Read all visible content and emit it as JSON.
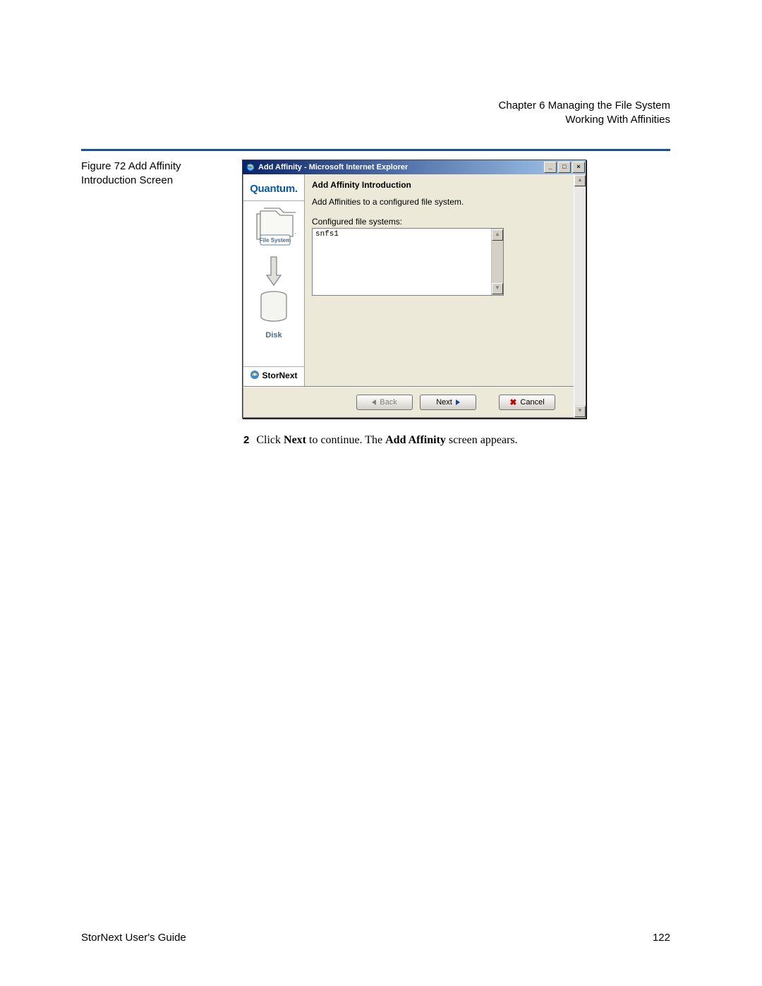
{
  "header": {
    "chapter": "Chapter 6  Managing the File System",
    "section": "Working With Affinities"
  },
  "figure": {
    "label_line1": "Figure 72  Add Affinity",
    "label_line2": "Introduction Screen"
  },
  "window": {
    "title": "Add Affinity - Microsoft Internet Explorer",
    "min": "_",
    "max": "□",
    "close": "×"
  },
  "sidebar": {
    "logo": "Quantum.",
    "fs_label": "File System",
    "disk_label": "Disk",
    "product": "StorNext"
  },
  "main": {
    "heading": "Add Affinity Introduction",
    "description": "Add Affinities to a configured file system.",
    "cfg_label": "Configured file systems:",
    "list_items": [
      "snfs1"
    ]
  },
  "buttons": {
    "back": "Back",
    "next": "Next",
    "cancel": "Cancel"
  },
  "instruction": {
    "num": "2",
    "prefix": "Click ",
    "bold1": "Next",
    "mid": " to continue. The ",
    "bold2": "Add Affinity",
    "suffix": " screen appears."
  },
  "footer": {
    "guide": "StorNext User's Guide",
    "page": "122"
  }
}
